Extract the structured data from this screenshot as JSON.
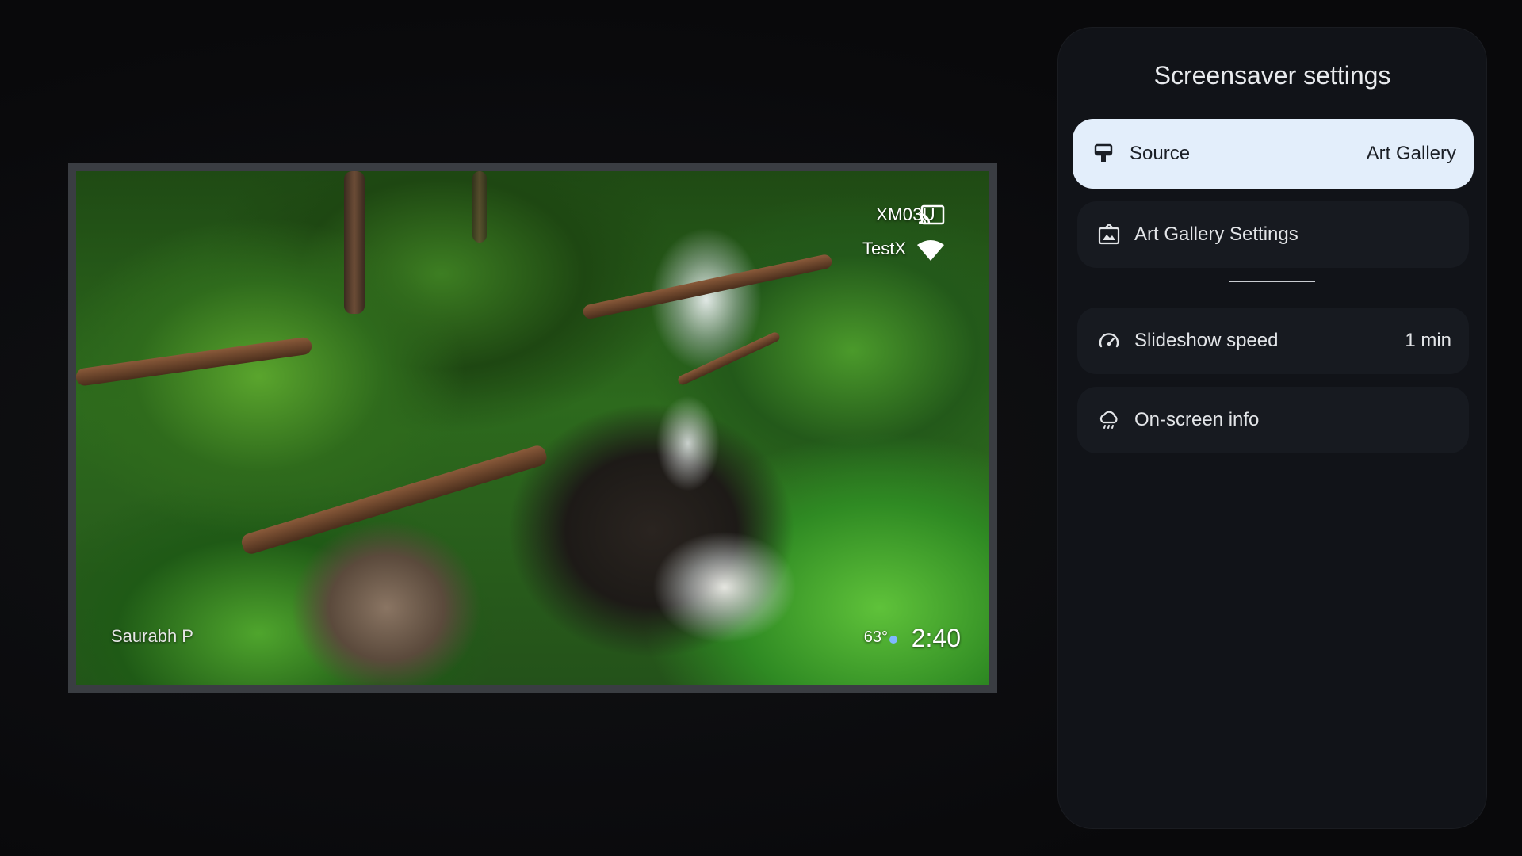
{
  "preview": {
    "device_name": "XM03U",
    "network_name": "TestX",
    "photo_credit": "Saurabh P",
    "temperature": "63°",
    "time": "2:40"
  },
  "panel": {
    "title": "Screensaver settings",
    "items": [
      {
        "label": "Source",
        "value": "Art Gallery",
        "icon": "paint-brush-icon",
        "selected": true
      },
      {
        "label": "Art Gallery Settings",
        "value": "",
        "icon": "gallery-image-icon",
        "selected": false
      },
      {
        "label": "Slideshow speed",
        "value": "1 min",
        "icon": "speedometer-icon",
        "selected": false
      },
      {
        "label": "On-screen info",
        "value": "",
        "icon": "weather-cloud-icon",
        "selected": false
      }
    ]
  },
  "colors": {
    "background": "#0b0c0f",
    "panel": "#111318",
    "row": "#171a20",
    "selected_row": "#e3eefb"
  }
}
